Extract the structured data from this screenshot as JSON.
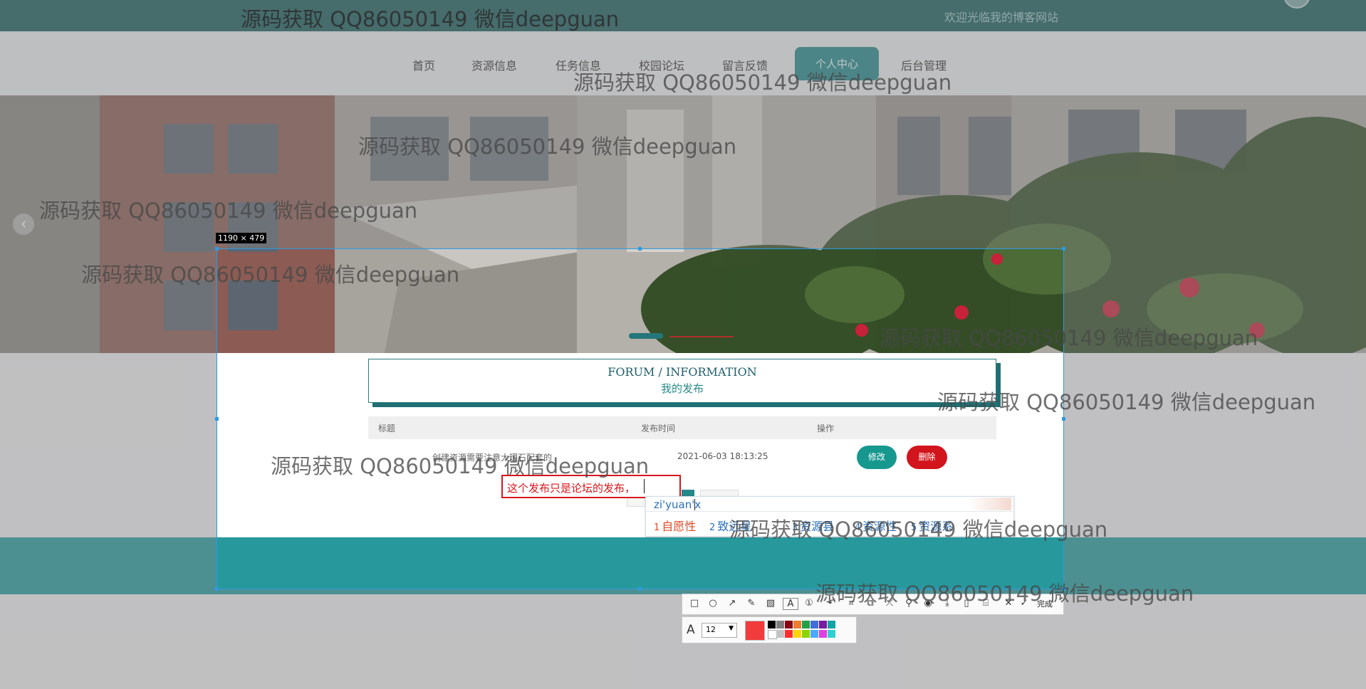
{
  "header": {
    "welcome": "欢迎光临我的博客网站"
  },
  "nav": {
    "items": [
      "首页",
      "资源信息",
      "任务信息",
      "校园论坛",
      "留言反馈",
      "个人中心",
      "后台管理"
    ],
    "active_index": 5
  },
  "banner": {
    "prev_icon": "‹"
  },
  "capture": {
    "size_label": "1190 × 479"
  },
  "forum": {
    "title_en": "FORUM / INFORMATION",
    "title_zh": "我的发布",
    "columns": [
      "标题",
      "发布时间",
      "操作"
    ],
    "rows": [
      {
        "title": "创建资源需要注意大理石配套的",
        "time": "2021-06-03 18:13:25"
      }
    ],
    "edit_label": "修改",
    "delete_label": "删除"
  },
  "annotation": {
    "text": "这个发布只是论坛的发布，"
  },
  "ime": {
    "composition": "zi'yuan'x",
    "candidates": [
      {
        "num": "1",
        "text": "自愿性"
      },
      {
        "num": "2",
        "text": "致远星"
      },
      {
        "num": "3",
        "text": "资源县"
      },
      {
        "num": "4",
        "text": "资源性"
      },
      {
        "num": "5",
        "text": "资源系"
      }
    ]
  },
  "toolbar": {
    "icons": [
      "rectangle-icon",
      "ellipse-icon",
      "arrow-icon",
      "pen-icon",
      "mosaic-icon",
      "text-icon",
      "number-icon",
      "undo-icon",
      "crop-icon",
      "copy-icon",
      "translate-icon",
      "pin-icon",
      "record-icon",
      "download-icon",
      "save-icon",
      "bookmark-icon",
      "close-icon",
      "finish-icon"
    ],
    "finish_label": "完成",
    "font_size": "12",
    "font_size_icon": "A",
    "current_color": "#f23b3b",
    "palette": [
      "#000000",
      "#7f7f7f",
      "#880015",
      "#ed7d31",
      "#22a045",
      "#3f6fd8",
      "#7a1aa0",
      "#12a3a3",
      "#ffffff",
      "#c3c3c3",
      "#ff2d2d",
      "#ffd400",
      "#8bd400",
      "#4aa8ff",
      "#e040e0",
      "#30d0d0"
    ]
  },
  "watermark": {
    "text": "源码获取 QQ86050149 微信deepguan"
  }
}
